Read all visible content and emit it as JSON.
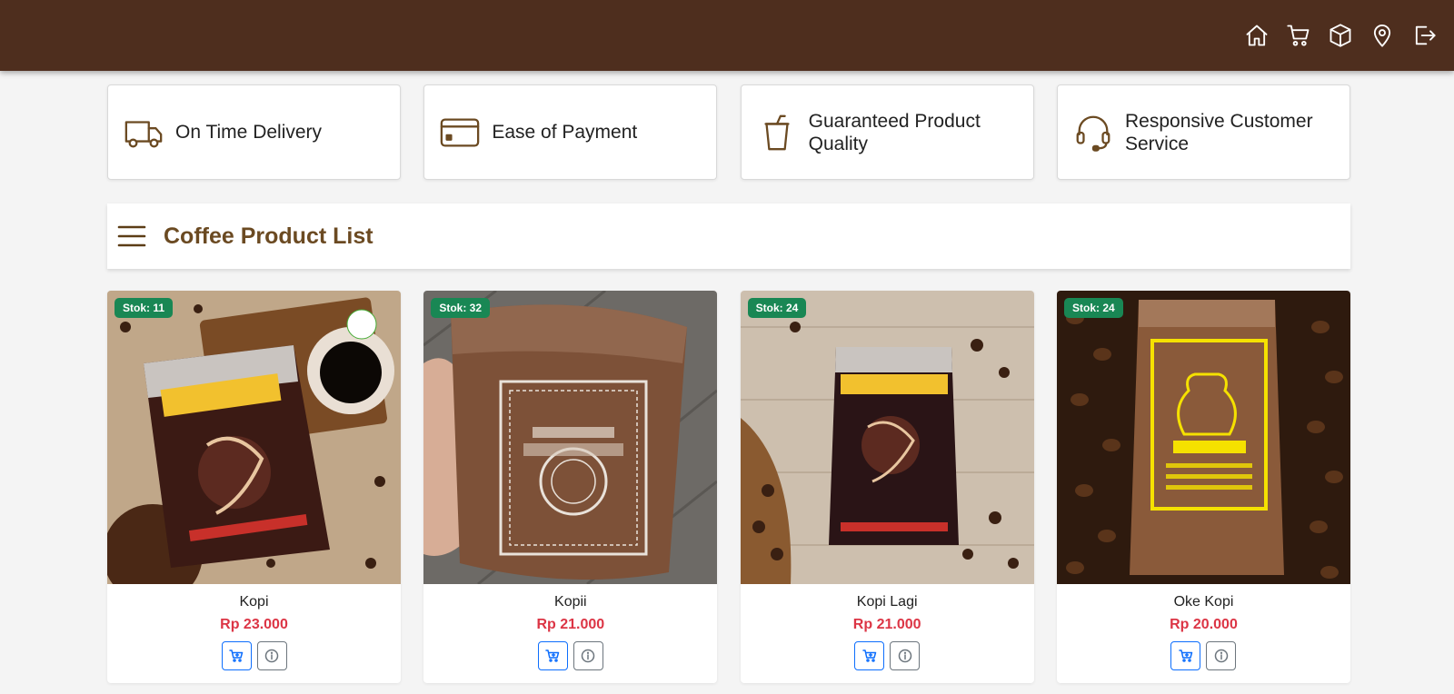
{
  "navbar": {
    "icons": [
      "home-icon",
      "cart-icon",
      "box-icon",
      "location-icon",
      "logout-icon"
    ],
    "background": "#4e2e1e"
  },
  "features": [
    {
      "label": "On Time Delivery",
      "icon": "truck-icon"
    },
    {
      "label": "Ease of Payment",
      "icon": "credit-card-icon"
    },
    {
      "label": "Guaranteed Product Quality",
      "icon": "cup-icon"
    },
    {
      "label": "Responsive Customer Service",
      "icon": "headset-icon"
    }
  ],
  "list_header": {
    "title": "Coffee Product List",
    "menu_icon": "hamburger-menu-icon"
  },
  "products": [
    {
      "name": "Kopi",
      "price": "Rp 23.000",
      "stock": "Stok: 11"
    },
    {
      "name": "Kopii",
      "price": "Rp 21.000",
      "stock": "Stok: 32"
    },
    {
      "name": "Kopi Lagi",
      "price": "Rp 21.000",
      "stock": "Stok: 24"
    },
    {
      "name": "Oke Kopi",
      "price": "Rp 20.000",
      "stock": "Stok: 24"
    }
  ],
  "colors": {
    "brand_brown": "#6b4a22",
    "price_red": "#dc3545",
    "stock_green": "#198754",
    "button_blue": "#0d6efd"
  }
}
